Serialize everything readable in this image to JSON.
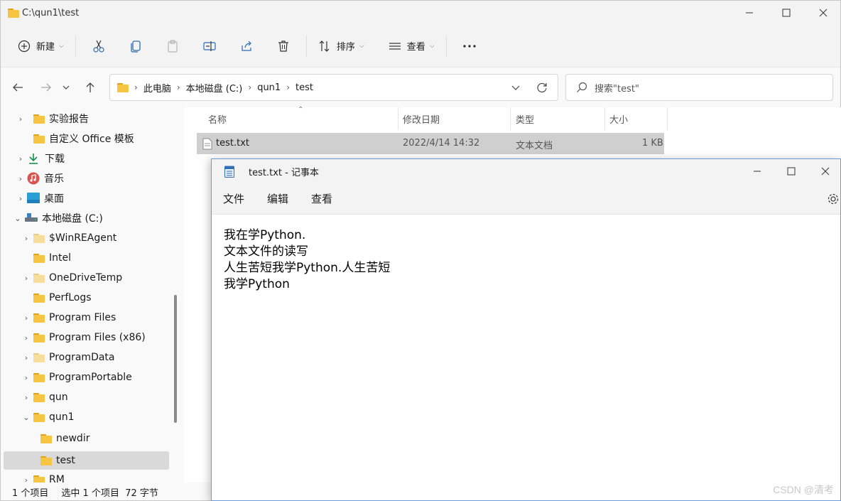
{
  "explorer": {
    "window_title": "C:\\qun1\\test",
    "toolbar": {
      "new_label": "新建",
      "sort_label": "排序",
      "view_label": "查看"
    },
    "address": {
      "crumbs": [
        "此电脑",
        "本地磁盘 (C:)",
        "qun1",
        "test"
      ]
    },
    "search": {
      "placeholder": "搜索\"test\""
    },
    "sidebar": {
      "items": [
        {
          "label": "实验报告",
          "icon": "folder-icon"
        },
        {
          "label": "自定义 Office 模板",
          "icon": "folder-icon"
        },
        {
          "label": "下载",
          "icon": "download-icon"
        },
        {
          "label": "音乐",
          "icon": "music-icon"
        },
        {
          "label": "桌面",
          "icon": "desktop-icon"
        },
        {
          "label": "本地磁盘 (C:)",
          "icon": "drive-icon"
        },
        {
          "label": "$WinREAgent",
          "icon": "folder-icon"
        },
        {
          "label": "Intel",
          "icon": "folder-icon"
        },
        {
          "label": "OneDriveTemp",
          "icon": "folder-icon"
        },
        {
          "label": "PerfLogs",
          "icon": "folder-icon"
        },
        {
          "label": "Program Files",
          "icon": "folder-icon"
        },
        {
          "label": "Program Files (x86)",
          "icon": "folder-icon"
        },
        {
          "label": "ProgramData",
          "icon": "folder-icon"
        },
        {
          "label": "ProgramPortable",
          "icon": "folder-icon"
        },
        {
          "label": "qun",
          "icon": "folder-icon"
        },
        {
          "label": "qun1",
          "icon": "folder-icon"
        },
        {
          "label": "newdir",
          "icon": "folder-icon"
        },
        {
          "label": "test",
          "icon": "folder-icon"
        },
        {
          "label": "RM",
          "icon": "folder-icon"
        }
      ]
    },
    "columns": {
      "name": "名称",
      "modified": "修改日期",
      "type": "类型",
      "size": "大小"
    },
    "files": [
      {
        "name": "test.txt",
        "modified": "2022/4/14 14:32",
        "type": "文本文档",
        "size": "1 KB"
      }
    ],
    "status": {
      "count": "1 个项目",
      "selected": "选中 1 个项目  72 字节"
    }
  },
  "notepad": {
    "window_title": "test.txt - 记事本",
    "menu": [
      "文件",
      "编辑",
      "查看"
    ],
    "lines": [
      "我在学Python.",
      "文本文件的读写",
      "人生苦短我学Python.人生苦短",
      "我学Python"
    ]
  },
  "watermark": "CSDN @清考"
}
